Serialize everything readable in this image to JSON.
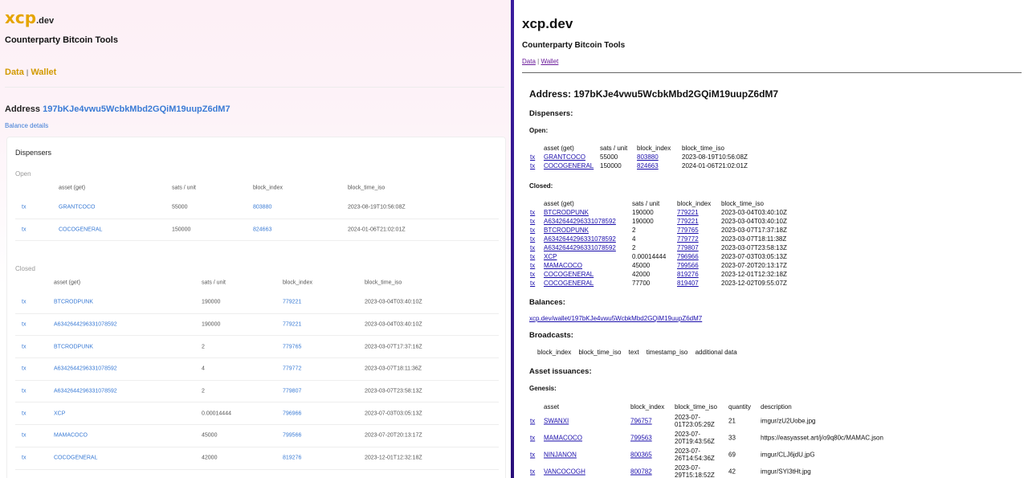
{
  "left": {
    "logo_main": "xcp",
    "logo_suffix": ".dev",
    "subtitle": "Counterparty Bitcoin Tools",
    "nav": {
      "data": "Data",
      "sep": "|",
      "wallet": "Wallet"
    },
    "address_label": "Address",
    "address": "197bKJe4vwu5WcbkMbd2GQiM19uupZ6dM7",
    "balance_details": "Balance details",
    "dispensers_title": "Dispensers",
    "open_label": "Open",
    "closed_label": "Closed",
    "headers": {
      "asset": "asset (get)",
      "sats": "sats / unit",
      "block": "block_index",
      "time": "block_time_iso"
    },
    "open_rows": [
      {
        "tx": "tx",
        "asset": "GRANTCOCO",
        "sats": "55000",
        "block": "803880",
        "time": "2023-08-19T10:56:08Z"
      },
      {
        "tx": "tx",
        "asset": "COCOGENERAL",
        "sats": "150000",
        "block": "824663",
        "time": "2024-01-06T21:02:01Z"
      }
    ],
    "closed_rows": [
      {
        "tx": "tx",
        "asset": "BTCRODPUNK",
        "sats": "190000",
        "block": "779221",
        "time": "2023-03-04T03:40:10Z"
      },
      {
        "tx": "tx",
        "asset": "A6342644296331078592",
        "sats": "190000",
        "block": "779221",
        "time": "2023-03-04T03:40:10Z"
      },
      {
        "tx": "tx",
        "asset": "BTCRODPUNK",
        "sats": "2",
        "block": "779765",
        "time": "2023-03-07T17:37:16Z"
      },
      {
        "tx": "tx",
        "asset": "A6342644296331078592",
        "sats": "4",
        "block": "779772",
        "time": "2023-03-07T18:11:36Z"
      },
      {
        "tx": "tx",
        "asset": "A6342644296331078592",
        "sats": "2",
        "block": "779807",
        "time": "2023-03-07T23:58:13Z"
      },
      {
        "tx": "tx",
        "asset": "XCP",
        "sats": "0.00014444",
        "block": "796966",
        "time": "2023-07-03T03:05:13Z"
      },
      {
        "tx": "tx",
        "asset": "MAMACOCO",
        "sats": "45000",
        "block": "799566",
        "time": "2023-07-20T20:13:17Z"
      },
      {
        "tx": "tx",
        "asset": "COCOGENERAL",
        "sats": "42000",
        "block": "819276",
        "time": "2023-12-01T12:32:18Z"
      }
    ]
  },
  "right": {
    "title": "xcp.dev",
    "subtitle": "Counterparty Bitcoin Tools",
    "nav": {
      "data": "Data",
      "sep": "|",
      "wallet": "Wallet"
    },
    "address_heading": "Address: 197bKJe4vwu5WcbkMbd2GQiM19uupZ6dM7",
    "dispensers": "Dispensers:",
    "open": "Open:",
    "closed": "Closed:",
    "balances": "Balances:",
    "balances_link": "xcp.dev/wallet/197bKJe4vwu5WcbkMbd2GQiM19uupZ6dM7",
    "broadcasts": "Broadcasts:",
    "broadcast_headers": [
      "block_index",
      "block_time_iso",
      "text",
      "timestamp_iso",
      "additional data"
    ],
    "asset_issuances": "Asset issuances:",
    "genesis": "Genesis:",
    "disp_headers": {
      "asset": "asset (get)",
      "sats": "sats / unit",
      "block": "block_index",
      "time": "block_time_iso"
    },
    "open_rows": [
      {
        "tx": "tx",
        "asset": "GRANTCOCO",
        "sats": "55000",
        "block": "803880",
        "time": "2023-08-19T10:56:08Z"
      },
      {
        "tx": "tx",
        "asset": "COCOGENERAL",
        "sats": "150000",
        "block": "824663",
        "time": "2024-01-06T21:02:01Z"
      }
    ],
    "closed_rows": [
      {
        "tx": "tx",
        "asset": "BTCRODPUNK",
        "sats": "190000",
        "block": "779221",
        "time": "2023-03-04T03:40:10Z"
      },
      {
        "tx": "tx",
        "asset": "A6342644296331078592",
        "sats": "190000",
        "block": "779221",
        "time": "2023-03-04T03:40:10Z"
      },
      {
        "tx": "tx",
        "asset": "BTCRODPUNK",
        "sats": "2",
        "block": "779765",
        "time": "2023-03-07T17:37:18Z"
      },
      {
        "tx": "tx",
        "asset": "A6342644296331078592",
        "sats": "4",
        "block": "779772",
        "time": "2023-03-07T18:11:38Z"
      },
      {
        "tx": "tx",
        "asset": "A6342644296331078592",
        "sats": "2",
        "block": "779807",
        "time": "2023-03-07T23:58:13Z"
      },
      {
        "tx": "tx",
        "asset": "XCP",
        "sats": "0.00014444",
        "block": "796966",
        "time": "2023-07-03T03:05:13Z"
      },
      {
        "tx": "tx",
        "asset": "MAMACOCO",
        "sats": "45000",
        "block": "799566",
        "time": "2023-07-20T20:13:17Z"
      },
      {
        "tx": "tx",
        "asset": "COCOGENERAL",
        "sats": "42000",
        "block": "819276",
        "time": "2023-12-01T12:32:18Z"
      },
      {
        "tx": "tx",
        "asset": "COCOGENERAL",
        "sats": "77700",
        "block": "819407",
        "time": "2023-12-02T09:55:07Z"
      }
    ],
    "genesis_headers": {
      "asset": "asset",
      "block": "block_index",
      "time": "block_time_iso",
      "qty": "quantity",
      "desc": "description"
    },
    "genesis_rows": [
      {
        "tx": "tx",
        "asset": "SWANXI",
        "block": "796757",
        "time1": "2023-07-",
        "time2": "01T23:05:29Z",
        "qty": "21",
        "desc": "imgur/zU2Uobe.jpg"
      },
      {
        "tx": "tx",
        "asset": "MAMACOCO",
        "block": "799563",
        "time1": "2023-07-",
        "time2": "20T19:43:56Z",
        "qty": "33",
        "desc": "https://easyasset.art/j/o9q80c/MAMAC.json"
      },
      {
        "tx": "tx",
        "asset": "NINJANON",
        "block": "800365",
        "time1": "2023-07-",
        "time2": "26T14:54:36Z",
        "qty": "69",
        "desc": "imgur/CLJ6jdU.jpG"
      },
      {
        "tx": "tx",
        "asset": "VANCOCOGH",
        "block": "800782",
        "time1": "2023-07-",
        "time2": "29T15:18:52Z",
        "qty": "42",
        "desc": "imgur/SYI3tHt.jpg"
      }
    ]
  }
}
